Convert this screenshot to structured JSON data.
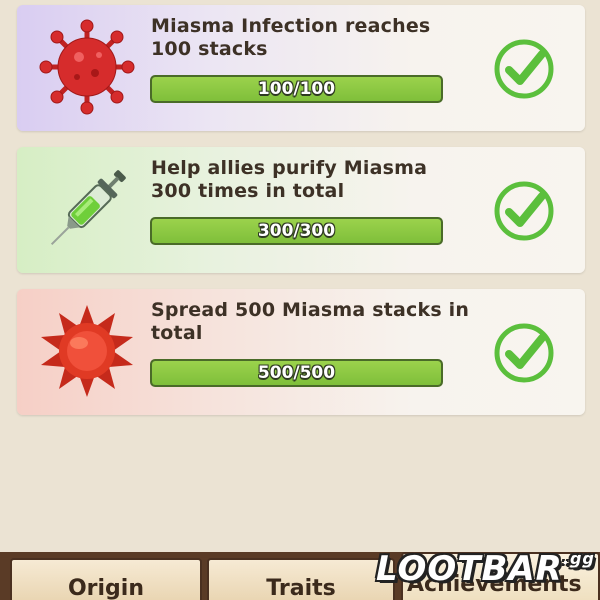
{
  "achievements": [
    {
      "title": "Miasma Infection reaches 100 stacks",
      "progress_text": "100/100",
      "progress": 1.0,
      "icon": "virus-icon",
      "completed": true
    },
    {
      "title": "Help allies purify Miasma 300 times in total",
      "progress_text": "300/300",
      "progress": 1.0,
      "icon": "syringe-icon",
      "completed": true
    },
    {
      "title": "Spread 500 Miasma stacks in total",
      "progress_text": "500/500",
      "progress": 1.0,
      "icon": "spiky-orb-icon",
      "completed": true
    }
  ],
  "tabs": [
    {
      "label": "Origin"
    },
    {
      "label": "Traits"
    },
    {
      "label": "Achievements"
    }
  ],
  "watermark": {
    "main": "LOOTBAR",
    "suffix": ".gg"
  },
  "colors": {
    "progress_fill": "#8cc843",
    "check": "#5bbf3c",
    "tabbar": "#5a3b26"
  }
}
